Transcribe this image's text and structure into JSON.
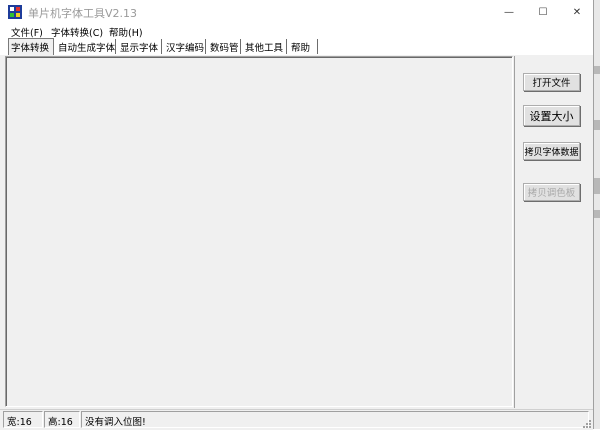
{
  "window": {
    "title": "单片机字体工具V2.13",
    "controls": {
      "minimize": "—",
      "maximize": "☐",
      "close": "✕"
    }
  },
  "menu": [
    {
      "label": "文件(F)"
    },
    {
      "label": "字体转换(C)"
    },
    {
      "label": "帮助(H)"
    }
  ],
  "tabs": [
    {
      "label": "字体转换",
      "active": true
    },
    {
      "label": "自动生成字体"
    },
    {
      "label": "显示字体"
    },
    {
      "label": "汉字编码"
    },
    {
      "label": "数码管"
    },
    {
      "label": "其他工具"
    },
    {
      "label": "帮助"
    }
  ],
  "buttons": {
    "open_file": "打开文件",
    "set_size": "设置大小",
    "copy_font_data": "拷贝字体数据",
    "copy_palette": "拷贝调色板"
  },
  "status": {
    "width": "宽:16",
    "height": "高:16",
    "message": "没有调入位图!"
  },
  "colors": {
    "window_bg": "#f0f0f0",
    "title_text": "#9a9a9a",
    "disabled_text": "#a8a8a8"
  },
  "icons": {
    "app": "app-icon",
    "resize": "resize-grip-icon"
  }
}
